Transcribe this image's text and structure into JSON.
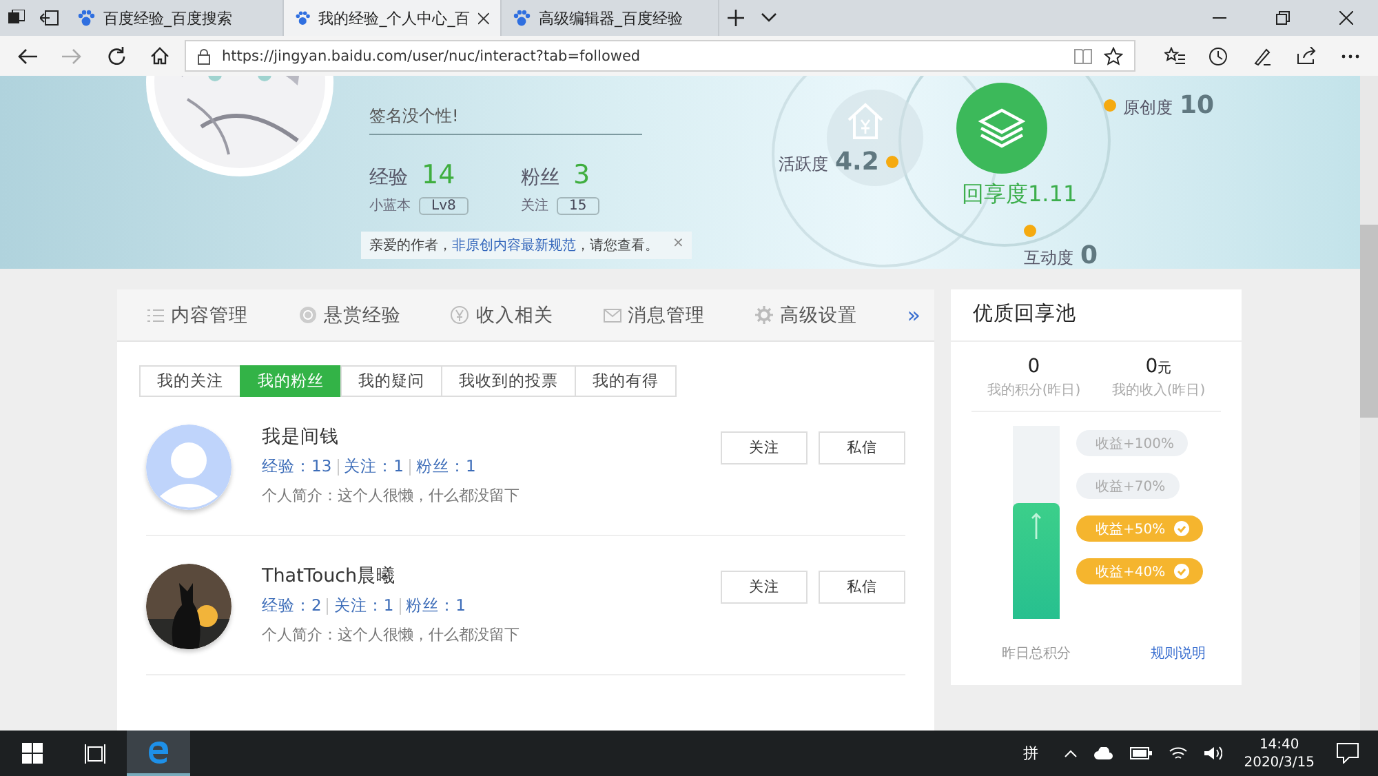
{
  "browser": {
    "tabs": [
      {
        "title": "百度经验_百度搜索",
        "selected": false
      },
      {
        "title": "我的经验_个人中心_百",
        "selected": true
      },
      {
        "title": "高级编辑器_百度经验",
        "selected": false
      }
    ],
    "url": "https://jingyan.baidu.com/user/nuc/interact?tab=followed"
  },
  "header": {
    "signature": "签名没个性!",
    "stats": [
      {
        "label": "经验",
        "value": "14",
        "sub_label": "小蓝本",
        "sub_value": "Lv8"
      },
      {
        "label": "粉丝",
        "value": "3",
        "sub_label": "关注",
        "sub_value": "15"
      }
    ],
    "notice": {
      "before": "亲爱的作者，",
      "link": "非原创内容最新规范",
      "after": "，请您查看。",
      "close": "×"
    },
    "main_gauge": {
      "label": "回享度",
      "value": "1.11"
    },
    "gauges": [
      {
        "kind": "left",
        "label": "活跃度",
        "value": "4.2"
      },
      {
        "kind": "top",
        "label": "原创度",
        "value": "10"
      },
      {
        "kind": "bottom",
        "label": "互动度",
        "value": "0"
      }
    ]
  },
  "nav": {
    "items": [
      {
        "label": "内容管理",
        "kind": "list"
      },
      {
        "label": "悬赏经验",
        "kind": "coin"
      },
      {
        "label": "收入相关",
        "kind": "yen"
      },
      {
        "label": "消息管理",
        "kind": "mail"
      },
      {
        "label": "高级设置",
        "kind": "gear"
      }
    ],
    "more": "»"
  },
  "subtabs": [
    {
      "label": "我的关注",
      "selected": false
    },
    {
      "label": "我的粉丝",
      "selected": true
    },
    {
      "label": "我的疑问",
      "selected": false
    },
    {
      "label": "我收到的投票",
      "selected": false
    },
    {
      "label": "我的有得",
      "selected": false
    }
  ],
  "fans": [
    {
      "kind": "default_avatar",
      "name": "我是间钱",
      "stats": [
        "经验：13",
        "关注：1",
        "粉丝：1"
      ],
      "bio": "个人简介：这个人很懒，什么都没留下",
      "buttons": [
        "关注",
        "私信"
      ]
    },
    {
      "kind": "picture",
      "name": "ThatTouch晨曦",
      "stats": [
        "经验：2",
        "关注：1",
        "粉丝：1"
      ],
      "bio": "个人简介：这个人很懒，什么都没留下",
      "buttons": [
        "关注",
        "私信"
      ]
    }
  ],
  "pool": {
    "title": "优质回享池",
    "metrics": [
      {
        "value": "0",
        "label": "我的积分(昨日)"
      },
      {
        "value": "0",
        "unit": "元",
        "label": "我的收入(昨日)"
      }
    ],
    "level": 0.6,
    "tiers": [
      {
        "label": "收益+100%",
        "achieved": false
      },
      {
        "label": "收益+70%",
        "achieved": false
      },
      {
        "label": "收益+50%",
        "achieved": true
      },
      {
        "label": "收益+40%",
        "achieved": true
      }
    ],
    "footer_left": "昨日总积分",
    "footer_right": "规则说明"
  },
  "taskbar": {
    "ime": "拼",
    "time": "14:40",
    "date": "2020/3/15"
  }
}
